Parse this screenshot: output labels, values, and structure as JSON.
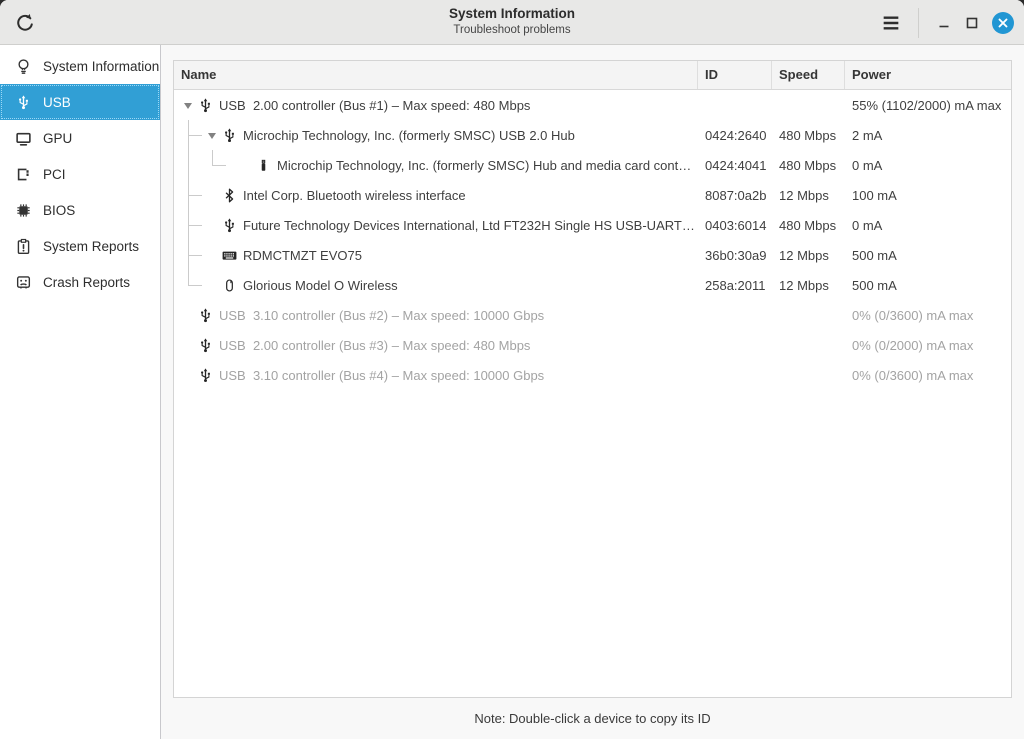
{
  "window": {
    "title": "System Information",
    "subtitle": "Troubleshoot problems"
  },
  "titlebar": {
    "refresh_icon": "refresh-icon",
    "menu_icon": "hamburger-menu-icon",
    "minimize_icon": "minimize-icon",
    "maximize_icon": "maximize-icon",
    "close_icon": "close-icon"
  },
  "colors": {
    "accent": "#319fd5",
    "close_button": "#2196d3",
    "selected_text": "#ffffff",
    "dim_text": "#a3a3a3"
  },
  "sidebar": {
    "items": [
      {
        "label": "System Information",
        "icon": "lightbulb-icon",
        "selected": false
      },
      {
        "label": "USB",
        "icon": "usb-icon",
        "selected": true
      },
      {
        "label": "GPU",
        "icon": "gpu-icon",
        "selected": false
      },
      {
        "label": "PCI",
        "icon": "pci-icon",
        "selected": false
      },
      {
        "label": "BIOS",
        "icon": "bios-icon",
        "selected": false
      },
      {
        "label": "System Reports",
        "icon": "report-icon",
        "selected": false
      },
      {
        "label": "Crash Reports",
        "icon": "crash-icon",
        "selected": false
      }
    ]
  },
  "table": {
    "columns": [
      "Name",
      "ID",
      "Speed",
      "Power"
    ],
    "rows": [
      {
        "level": 0,
        "expander": true,
        "tree": [],
        "icon": "usb-icon",
        "name": "USB  2.00 controller (Bus #1) – Max speed: 480 Mbps",
        "id": "",
        "speed": "",
        "power": "55% (1102/2000) mA max",
        "dim": false
      },
      {
        "level": 1,
        "expander": true,
        "tree": [
          "tee"
        ],
        "icon": "usb-icon",
        "name": "Microchip Technology, Inc. (formerly SMSC) USB 2.0 Hub",
        "id": "0424:2640",
        "speed": "480 Mbps",
        "power": "2 mA",
        "dim": false
      },
      {
        "level": 2,
        "expander": false,
        "tree": [
          "pipe",
          "ell"
        ],
        "icon": "usb-drive-icon",
        "name": "Microchip Technology, Inc. (formerly SMSC) Hub and media card cont…",
        "id": "0424:4041",
        "speed": "480 Mbps",
        "power": "0 mA",
        "dim": false
      },
      {
        "level": 1,
        "expander": false,
        "tree": [
          "tee"
        ],
        "icon": "bluetooth-icon",
        "name": "Intel Corp. Bluetooth wireless interface",
        "id": "8087:0a2b",
        "speed": "12 Mbps",
        "power": "100 mA",
        "dim": false
      },
      {
        "level": 1,
        "expander": false,
        "tree": [
          "tee"
        ],
        "icon": "usb-icon",
        "name": "Future Technology Devices International, Ltd FT232H Single HS USB-UART…",
        "id": "0403:6014",
        "speed": "480 Mbps",
        "power": "0 mA",
        "dim": false
      },
      {
        "level": 1,
        "expander": false,
        "tree": [
          "tee"
        ],
        "icon": "keyboard-icon",
        "name": "RDMCTMZT EVO75",
        "id": "36b0:30a9",
        "speed": "12 Mbps",
        "power": "500 mA",
        "dim": false
      },
      {
        "level": 1,
        "expander": false,
        "tree": [
          "ell"
        ],
        "icon": "mouse-icon",
        "name": "Glorious Model O Wireless",
        "id": "258a:2011",
        "speed": "12 Mbps",
        "power": "500 mA",
        "dim": false
      },
      {
        "level": 0,
        "expander": false,
        "tree": [],
        "icon": "usb-icon",
        "name": "USB  3.10 controller (Bus #2) – Max speed: 10000 Gbps",
        "id": "",
        "speed": "",
        "power": "0% (0/3600) mA max",
        "dim": true
      },
      {
        "level": 0,
        "expander": false,
        "tree": [],
        "icon": "usb-icon",
        "name": "USB  2.00 controller (Bus #3) – Max speed: 480 Mbps",
        "id": "",
        "speed": "",
        "power": "0% (0/2000) mA max",
        "dim": true
      },
      {
        "level": 0,
        "expander": false,
        "tree": [],
        "icon": "usb-icon",
        "name": "USB  3.10 controller (Bus #4) – Max speed: 10000 Gbps",
        "id": "",
        "speed": "",
        "power": "0% (0/3600) mA max",
        "dim": true
      }
    ]
  },
  "footer": {
    "note": "Note: Double-click a device to copy its ID"
  }
}
